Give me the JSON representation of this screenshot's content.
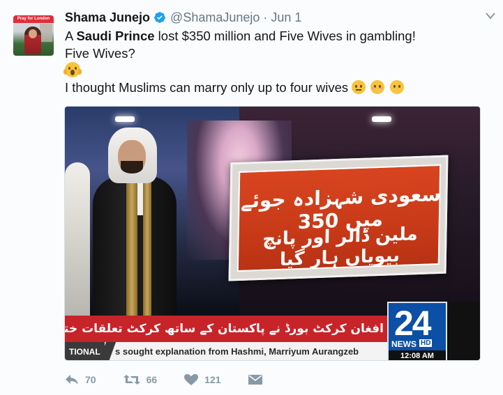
{
  "tweet": {
    "display_name": "Shama Junejo",
    "handle": "@ShamaJunejo",
    "separator": "·",
    "timestamp": "Jun 1",
    "avatar_caption": "Pray for London",
    "line1_pre": "A ",
    "line1_bold": "Saudi Prince",
    "line1_post": " lost $350 million and Five Wives in gambling!",
    "line2": "Five Wives?",
    "line4": "I thought Muslims can marry only up to four wives",
    "emojis_line3": [
      "scream-emoji"
    ],
    "emojis_line4": [
      "neutral-face-emoji",
      "flushed-face-emoji",
      "no-mouth-emoji"
    ]
  },
  "media": {
    "headline_urdu_line1": "سعودی شہزادہ جوئے میں 350",
    "headline_urdu_line2": "ملین ڈالر اور پانچ بیویاں ہار گیا",
    "ticker_urdu": "افغان کرکٹ بورڈ نے پاکستان کے ساتھ کرکٹ تعلقات ختم کر دیے ، افغان کرکٹ بو",
    "ticker_label": "TIONAL",
    "ticker_english": "s sought explanation from Hashmi, Marriyum Aurangzeb",
    "channel_number": "24",
    "channel_news": "NEWS",
    "channel_hd": "HD",
    "clock": "12:08 AM"
  },
  "actions": {
    "replies": "70",
    "retweets": "66",
    "likes": "121"
  },
  "colors": {
    "accent": "#1da1f2",
    "muted": "#657786",
    "action": "#8899a6",
    "panel_red": "#c83a18",
    "channel_blue": "#0c4fa6"
  }
}
